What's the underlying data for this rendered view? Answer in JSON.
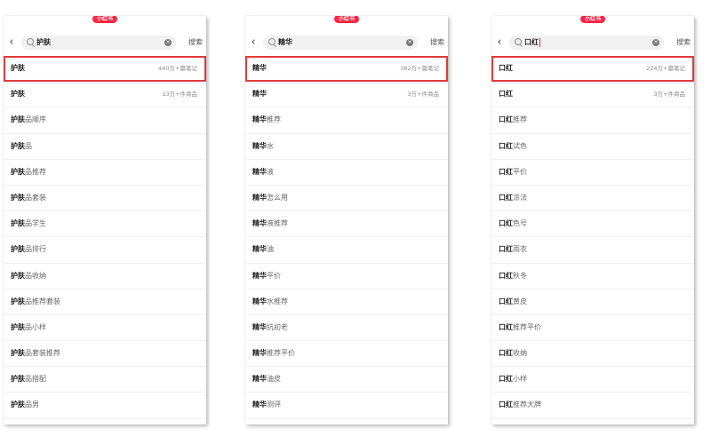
{
  "logo_text": "小红书",
  "search_button": "搜索",
  "colors": {
    "brand": "#ff2442",
    "highlight_border": "#e03a3a"
  },
  "icons": {
    "back": "chevron-left-icon",
    "search": "search-icon",
    "clear": "clear-icon"
  },
  "panels": [
    {
      "query": "护肤",
      "suggestions": [
        {
          "bold": "护肤",
          "rest": "",
          "meta": "440万+篇笔记"
        },
        {
          "bold": "护肤",
          "rest": "",
          "meta": "13万+件商品"
        },
        {
          "bold": "护肤",
          "rest": "品顺序",
          "meta": ""
        },
        {
          "bold": "护肤",
          "rest": "品",
          "meta": ""
        },
        {
          "bold": "护肤",
          "rest": "品推荐",
          "meta": ""
        },
        {
          "bold": "护肤",
          "rest": "品套装",
          "meta": ""
        },
        {
          "bold": "护肤",
          "rest": "品学生",
          "meta": ""
        },
        {
          "bold": "护肤",
          "rest": "品排行",
          "meta": ""
        },
        {
          "bold": "护肤",
          "rest": "品收纳",
          "meta": ""
        },
        {
          "bold": "护肤",
          "rest": "品推荐套装",
          "meta": ""
        },
        {
          "bold": "护肤",
          "rest": "品小样",
          "meta": ""
        },
        {
          "bold": "护肤",
          "rest": "品套装推荐",
          "meta": ""
        },
        {
          "bold": "护肤",
          "rest": "品搭配",
          "meta": ""
        },
        {
          "bold": "护肤",
          "rest": "品男",
          "meta": ""
        }
      ]
    },
    {
      "query": "精华",
      "suggestions": [
        {
          "bold": "精华",
          "rest": "",
          "meta": "382万+篇笔记"
        },
        {
          "bold": "精华",
          "rest": "",
          "meta": "3万+件商品"
        },
        {
          "bold": "精华",
          "rest": "推荐",
          "meta": ""
        },
        {
          "bold": "精华",
          "rest": "水",
          "meta": ""
        },
        {
          "bold": "精华",
          "rest": "液",
          "meta": ""
        },
        {
          "bold": "精华",
          "rest": "怎么用",
          "meta": ""
        },
        {
          "bold": "精华",
          "rest": "液推荐",
          "meta": ""
        },
        {
          "bold": "精华",
          "rest": "油",
          "meta": ""
        },
        {
          "bold": "精华",
          "rest": "平价",
          "meta": ""
        },
        {
          "bold": "精华",
          "rest": "水推荐",
          "meta": ""
        },
        {
          "bold": "精华",
          "rest": "抗初老",
          "meta": ""
        },
        {
          "bold": "精华",
          "rest": "推荐平价",
          "meta": ""
        },
        {
          "bold": "精华",
          "rest": "油皮",
          "meta": ""
        },
        {
          "bold": "精华",
          "rest": "测评",
          "meta": ""
        }
      ]
    },
    {
      "query": "口红",
      "suggestions": [
        {
          "bold": "口红",
          "rest": "",
          "meta": "224万+篇笔记"
        },
        {
          "bold": "口红",
          "rest": "",
          "meta": "3万+件商品"
        },
        {
          "bold": "口红",
          "rest": "推荐",
          "meta": ""
        },
        {
          "bold": "口红",
          "rest": "试色",
          "meta": ""
        },
        {
          "bold": "口红",
          "rest": "平价",
          "meta": ""
        },
        {
          "bold": "口红",
          "rest": "涂法",
          "meta": ""
        },
        {
          "bold": "口红",
          "rest": "色号",
          "meta": ""
        },
        {
          "bold": "口红",
          "rest": "雨衣",
          "meta": ""
        },
        {
          "bold": "口红",
          "rest": "秋冬",
          "meta": ""
        },
        {
          "bold": "口红",
          "rest": "黄皮",
          "meta": ""
        },
        {
          "bold": "口红",
          "rest": "推荐平价",
          "meta": ""
        },
        {
          "bold": "口红",
          "rest": "收纳",
          "meta": ""
        },
        {
          "bold": "口红",
          "rest": "小样",
          "meta": ""
        },
        {
          "bold": "口红",
          "rest": "推荐大牌",
          "meta": ""
        }
      ]
    }
  ]
}
